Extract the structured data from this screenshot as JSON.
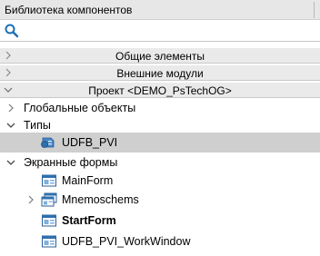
{
  "panel": {
    "title": "Библиотека компонентов"
  },
  "search": {
    "value": "",
    "placeholder": ""
  },
  "sections": [
    {
      "label": "Общие элементы",
      "expanded": false
    },
    {
      "label": "Внешние модули",
      "expanded": false
    },
    {
      "label": "Проект <DEMO_PsTechOG>",
      "expanded": true
    }
  ],
  "tree": {
    "global_objects": {
      "label": "Глобальные объекты",
      "expanded": false
    },
    "types": {
      "label": "Типы",
      "expanded": true,
      "items": [
        {
          "label": "UDFB_PVI",
          "icon": "function-block-icon",
          "selected": true
        }
      ]
    },
    "screen_forms": {
      "label": "Экранные формы",
      "expanded": true,
      "items": [
        {
          "label": "MainForm",
          "icon": "form-icon",
          "bold": false,
          "has_children": false
        },
        {
          "label": "Mnemoschems",
          "icon": "form-group-icon",
          "bold": false,
          "has_children": true
        },
        {
          "label": "StartForm",
          "icon": "form-icon",
          "bold": true,
          "has_children": false
        },
        {
          "label": "UDFB_PVI_WorkWindow",
          "icon": "form-icon",
          "bold": false,
          "has_children": false
        }
      ]
    }
  },
  "colors": {
    "selection": "#cfcfcf",
    "section_bg": "#eaeaea",
    "accent": "#1f6fb5"
  }
}
